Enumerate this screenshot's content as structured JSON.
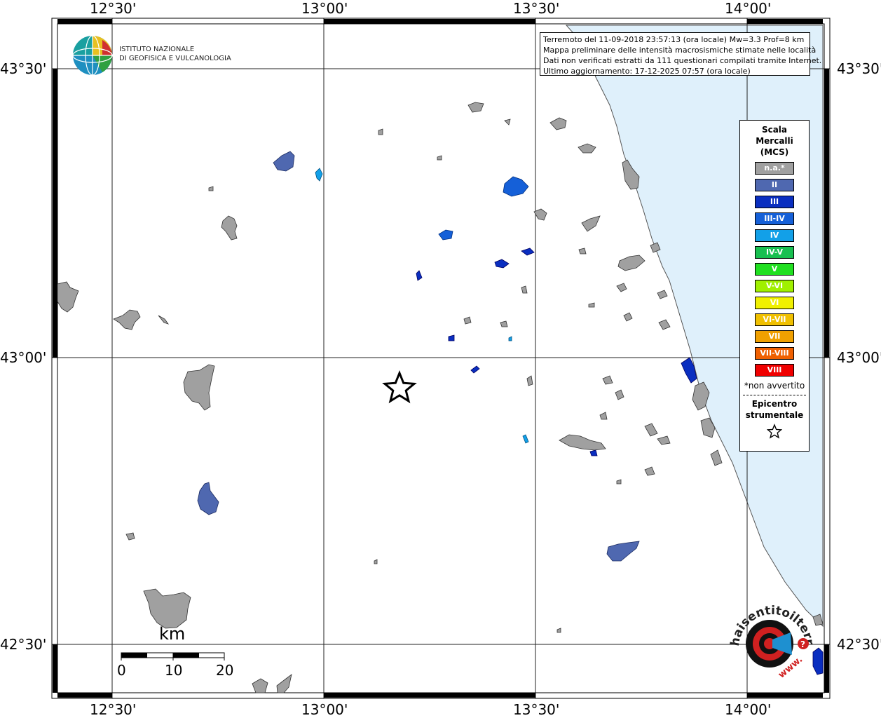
{
  "map": {
    "longitude_ticks": [
      "12°30'",
      "13°00'",
      "13°30'",
      "14°00'"
    ],
    "latitude_ticks": [
      "43°30'",
      "43°00'",
      "42°30'"
    ]
  },
  "institute": {
    "line1": "ISTITUTO NAZIONALE",
    "line2": "DI GEOFISICA E VULCANOLOGIA"
  },
  "info_box": {
    "line1": "Terremoto del 11-09-2018 23:57:13 (ora locale) Mw=3.3 Prof=8 km",
    "line2": "Mappa preliminare delle intensità macrosismiche stimate nelle località",
    "line3": "Dati non verificati estratti da 111 questionari compilati tramite Internet.",
    "line4": "Ultimo aggiornamento: 17-12-2025 07:57 (ora locale)"
  },
  "legend": {
    "title_line1": "Scala",
    "title_line2": "Mercalli",
    "title_line3": "(MCS)",
    "items": [
      {
        "label": "n.a.*",
        "color": "#a0a0a0"
      },
      {
        "label": "II",
        "color": "#4f68b0"
      },
      {
        "label": "III",
        "color": "#0a2ec0"
      },
      {
        "label": "III-IV",
        "color": "#1560d8"
      },
      {
        "label": "IV",
        "color": "#12a0e8"
      },
      {
        "label": "IV-V",
        "color": "#18c050"
      },
      {
        "label": "V",
        "color": "#20e020"
      },
      {
        "label": "V-VI",
        "color": "#a0f000"
      },
      {
        "label": "VI",
        "color": "#f0f000"
      },
      {
        "label": "VI-VII",
        "color": "#f0c000"
      },
      {
        "label": "VII",
        "color": "#f0a000"
      },
      {
        "label": "VII-VIII",
        "color": "#f06000"
      },
      {
        "label": "VIII",
        "color": "#f00000"
      }
    ],
    "note": "*non avvertito",
    "epicenter_line1": "Epicentro",
    "epicenter_line2": "strumentale"
  },
  "scale_bar": {
    "unit": "km",
    "ticks": [
      "0",
      "10",
      "20"
    ]
  },
  "hst_logo": {
    "text": "haisentitoilterremoto.it",
    "prefix": "www."
  },
  "colors": {
    "sea": "#dff0fb",
    "not_felt": "#a0a0a0",
    "int_II": "#4f68b0",
    "int_III": "#0a2ec0",
    "int_IIIIV": "#1560d8",
    "int_IV": "#12a0e8"
  }
}
